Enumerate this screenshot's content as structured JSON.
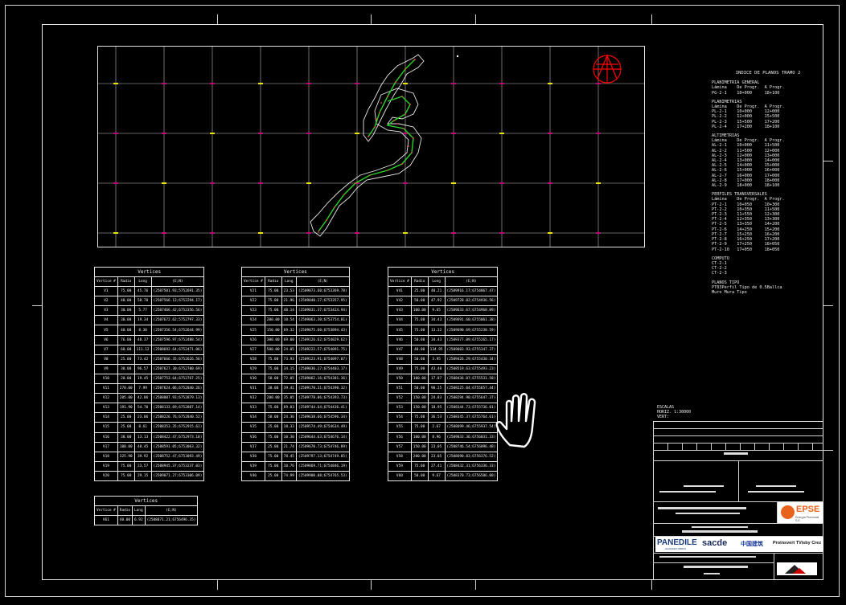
{
  "index": {
    "title": "INDICE  DE  PLANOS TRAMO 2",
    "sections": [
      {
        "heading": "PLANIMETRIA GENERAL",
        "rows": [
          "Lámina    De Progr.  A Progr.",
          "PG-2-1    10+000     18+100"
        ]
      },
      {
        "heading": "PLANIMETRIAS",
        "rows": [
          "Lámina    De Progr.  A Progr.",
          "PL-2-1    10+000     12+000",
          "PL-2-2    12+000     15+500",
          "PL-2-3    15+500     17+200",
          "PL-2-4    17+200     18+100"
        ]
      },
      {
        "heading": "ALTIMETRIAS",
        "rows": [
          "Lámina    De Progr.  A Progr.",
          "AL-2-1    10+000     11+500",
          "AL-2-2    11+500     12+000",
          "AL-2-3    12+000     13+000",
          "AL-2-4    13+000     14+000",
          "AL-2-5    14+000     15+000",
          "AL-2-6    15+000     16+000",
          "AL-2-7    16+000     17+000",
          "AL-2-8    17+000     18+000",
          "AL-2-9    18+000     18+100"
        ]
      },
      {
        "heading": "PERFILES TRANSVERSALES",
        "rows": [
          "Lámina    De Progr.  A Progr.",
          "PT-2-1    10+050     10+300",
          "PT-2-2    10+350     11+500",
          "PT-2-3    11+550     12+300",
          "PT-2-4    12+350     13+300",
          "PT-2-5    13+350     14+200",
          "PT-2-6    14+250     15+200",
          "PT-2-7    15+250     16+200",
          "PT-2-8    16+250     17+200",
          "PT-2-9    17+250     18+050",
          "PT-2-10   17+050     18+050"
        ]
      },
      {
        "heading": "COMPUTO",
        "rows": [
          "CT-2-1",
          "CT-2-2",
          "CT-2-3"
        ]
      },
      {
        "heading": "PLANOS TIPO",
        "rows": [
          "PT03Perfil Tipo de 0.5Ballca",
          "Muro Mura Tipo"
        ]
      }
    ]
  },
  "tables": [
    {
      "title": "Vertices",
      "headers": [
        "Vertice #",
        "Radio",
        "Long",
        "(E;N)"
      ],
      "rows": [
        [
          "V1",
          "75.00",
          "45.76",
          "(2507501.93;5752691.35)"
        ],
        [
          "V2",
          "40.00",
          "58.70",
          "(2507566.13;6752294.17)"
        ],
        [
          "V3",
          "30.00",
          "5.77",
          "(2507466.42;6752356.56)"
        ],
        [
          "V4",
          "30.00",
          "19.34",
          "(2507672.62;5752797.33)"
        ],
        [
          "V5",
          "40.00",
          "8.30",
          "(2507356.54;6752644.99)"
        ],
        [
          "V6",
          "76.00",
          "48.37",
          "(2507596.97;6752488.54)"
        ],
        [
          "V7",
          "60.00",
          "111.12",
          "(2508692.64;6752471.06)"
        ],
        [
          "V8",
          "25.00",
          "73.42",
          "(2507666.35;6752626.56)"
        ],
        [
          "V9",
          "30.00",
          "96.57",
          "(2507627.30;6752700.69)"
        ],
        [
          "V10",
          "20.00",
          "19.45",
          "(2507753.64;6752767.25)"
        ],
        [
          "V11",
          "270.00",
          "7.99",
          "(2507624.06;6752840.26)"
        ],
        [
          "V12",
          "205.00",
          "42.06",
          "(2508007.93;6752879.13)"
        ],
        [
          "V13",
          "191.90",
          "54.70",
          "(2508133.69;6752887.14)"
        ],
        [
          "V14",
          "25.00",
          "23.06",
          "(2508226.76;6752840.52)"
        ],
        [
          "V15",
          "25.00",
          "8.61",
          "(2508353.35;6752915.61)"
        ],
        [
          "V16",
          "30.00",
          "13.13",
          "(2508422.47;6752973.10)"
        ],
        [
          "V17",
          "100.00",
          "40.45",
          "(2508591.05;6753063.32)"
        ],
        [
          "V18",
          "325.90",
          "39.92",
          "(2508752.47;6753093.49)"
        ],
        [
          "V19",
          "75.00",
          "23.57",
          "(2508945.37;6753237.03)"
        ],
        [
          "V20",
          "75.00",
          "29.15",
          "(2509071.27;6753306.09)"
        ]
      ]
    },
    {
      "title": "Vertices",
      "headers": [
        "Vertice #",
        "Radio",
        "Long",
        "(E;N)"
      ],
      "rows": [
        [
          "V21",
          "75.00",
          "23.53",
          "(2509073.60;6753369.78)"
        ],
        [
          "V22",
          "75.00",
          "21.96",
          "(2509040.17;6753357.95)"
        ],
        [
          "V23",
          "75.00",
          "48.14",
          "(2509031.37;6753424.94)"
        ],
        [
          "V24",
          "200.00",
          "10.54",
          "(2509063.30;6753754.81)"
        ],
        [
          "V25",
          "150.00",
          "69.32",
          "(2509075.60;6753894.43)"
        ],
        [
          "V26",
          "300.00",
          "69.00",
          "(2509126.62;6754029.62)"
        ],
        [
          "V27",
          "500.00",
          "24.05",
          "(2509222.57;6754091.75)"
        ],
        [
          "V28",
          "75.00",
          "73.93",
          "(2509123.91;6754097.07)"
        ],
        [
          "V29",
          "75.00",
          "34.15",
          "(2509036.17;6754403.17)"
        ],
        [
          "V30",
          "50.00",
          "72.05",
          "(2509062.16;6754381.36)"
        ],
        [
          "V31",
          "30.00",
          "39.41",
          "(2509170.31;6754390.32)"
        ],
        [
          "V32",
          "200.00",
          "35.05",
          "(2509778.06;6754393.73)"
        ],
        [
          "V33",
          "75.00",
          "69.03",
          "(2509744.64;6754436.41)"
        ],
        [
          "V34",
          "50.00",
          "24.36",
          "(2509638.66;6754596.34)"
        ],
        [
          "V35",
          "25.00",
          "18.33",
          "(2509574.49;6754634.49)"
        ],
        [
          "V36",
          "75.00",
          "10.30",
          "(2509644.63;6754676.14)"
        ],
        [
          "V37",
          "25.00",
          "21.74",
          "(2509670.73;6754746.89)"
        ],
        [
          "V38",
          "75.00",
          "78.45",
          "(2509797.13;6754749.85)"
        ],
        [
          "V39",
          "75.00",
          "10.76",
          "(2509869.71;6754846.19)"
        ],
        [
          "V40",
          "25.00",
          "74.99",
          "(2509900.08;6754765.53)"
        ]
      ]
    },
    {
      "title": "Vertices",
      "headers": [
        "Vertice #",
        "Radio",
        "Long",
        "(E;N)"
      ],
      "rows": [
        [
          "V41",
          "25.00",
          "40.21",
          "(2509916.17;6754867.47)"
        ],
        [
          "V42",
          "50.00",
          "47.92",
          "(2509728.02;6754936.56)"
        ],
        [
          "V43",
          "100.00",
          "9.65",
          "(2509633.67;6754968.09)"
        ],
        [
          "V44",
          "75.00",
          "34.43",
          "(2509691.60;6755061.38)"
        ],
        [
          "V45",
          "75.00",
          "13.32",
          "(2509690.69;6755238.59)"
        ],
        [
          "V46",
          "50.00",
          "34.43",
          "(2509377.09;6755265.17)"
        ],
        [
          "V47",
          "40.00",
          "134.95",
          "(2509603.93;6755347.37)"
        ],
        [
          "V48",
          "50.00",
          "3.95",
          "(2509426.29;6755430.34)"
        ],
        [
          "V49",
          "75.00",
          "43.40",
          "(2508519.63;6755493.23)"
        ],
        [
          "V50",
          "100.00",
          "17.87",
          "(2508436.07;6755531.58)"
        ],
        [
          "V51",
          "50.00",
          "90.25",
          "(2508225.04;6755657.44)"
        ],
        [
          "V52",
          "150.00",
          "24.83",
          "(2508294.90;6755647.37)"
        ],
        [
          "V53",
          "150.00",
          "18.95",
          "(2508344.73;6755736.01)"
        ],
        [
          "V54",
          "75.00",
          "36.53",
          "(2508345.37;6755764.61)"
        ],
        [
          "V55",
          "75.00",
          "2.67",
          "(2508699.46;6755937.54)"
        ],
        [
          "V56",
          "100.00",
          "8.96",
          "(2509033.36;6756031.33)"
        ],
        [
          "V57",
          "150.00",
          "23.05",
          "(2508746.54;6756096.48)"
        ],
        [
          "V58",
          "200.00",
          "23.05",
          "(2508690.83;6756376.52)"
        ],
        [
          "V59",
          "75.00",
          "27.41",
          "(2508432.31;6756336.33)"
        ],
        [
          "V60",
          "50.00",
          "9.67",
          "(2508370.73;6756506.00)"
        ]
      ]
    },
    {
      "title": "Vertices",
      "headers": [
        "Vertice #",
        "Radio",
        "Long",
        "(E;N)"
      ],
      "rows": [
        [
          "V61",
          "40.00",
          "6.92",
          "(2508071.21;6756496.35)"
        ]
      ]
    }
  ],
  "escalas": {
    "title": "ESCALAS",
    "h": "HORIZ. 1:30000",
    "v": "VERT:"
  },
  "logos": {
    "epse": "EPSE",
    "epse_sub": "Energía Provincial S.E.",
    "panedile": "PANEDILE",
    "panedile_sub": "GRANDES OBRAS",
    "sacde": "sacde",
    "china": "中国建筑",
    "proinsvert": "Proinsvert TVisby Crez"
  },
  "colors": {
    "grid_tick": "#c4007a",
    "grid_tick_alt": "#e8e800",
    "road_fill": "#2bd22b",
    "road_points": "#ff3a3a",
    "north_symbol": "#ff0000"
  },
  "icons": {
    "cursor": "pan-hand-icon",
    "north": "north-arrow-icon"
  }
}
